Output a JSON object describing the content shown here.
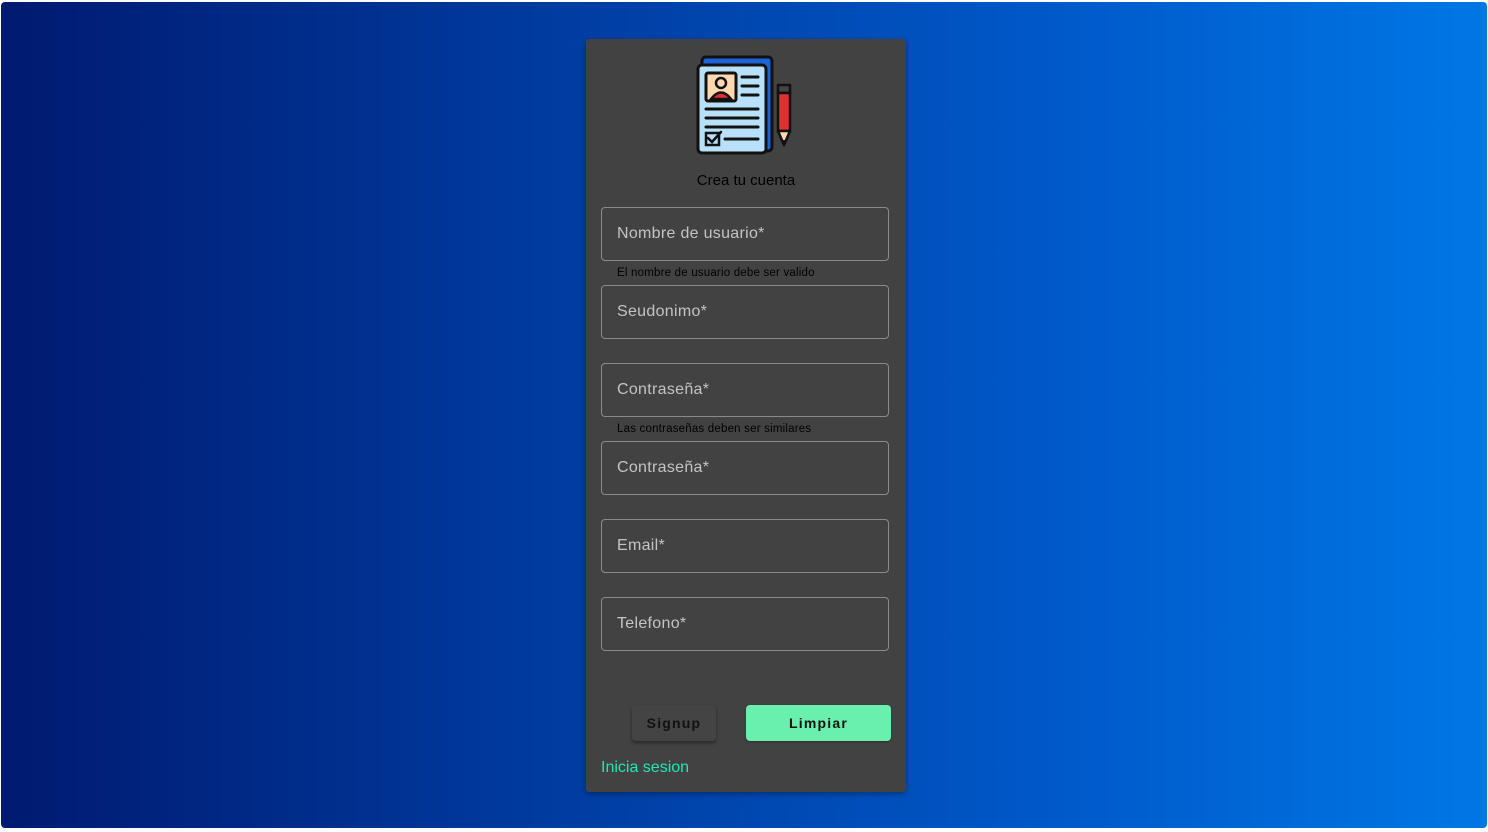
{
  "form": {
    "title": "Crea tu cuenta",
    "fields": [
      {
        "placeholder": "Nombre de usuario*",
        "value": ""
      },
      {
        "placeholder": "Seudonimo*",
        "value": ""
      },
      {
        "placeholder": "Contraseña*",
        "value": ""
      },
      {
        "placeholder": "Contraseña*",
        "value": ""
      },
      {
        "placeholder": "Email*",
        "value": ""
      },
      {
        "placeholder": "Telefono*",
        "value": ""
      }
    ],
    "hints": {
      "username": "El nombre de usuario debe ser valido",
      "password": "Las contraseñas deben ser similares"
    },
    "buttons": {
      "signup": "Signup",
      "clear": "Limpiar"
    },
    "login_link": "Inicia sesion"
  },
  "icons": {
    "logo": "resume-document-pencil-icon"
  },
  "colors": {
    "card_bg": "#424242",
    "accent_button": "#69f0ae",
    "link": "#1de9b6",
    "gradient_start": "#001a70",
    "gradient_end": "#0077e6"
  }
}
